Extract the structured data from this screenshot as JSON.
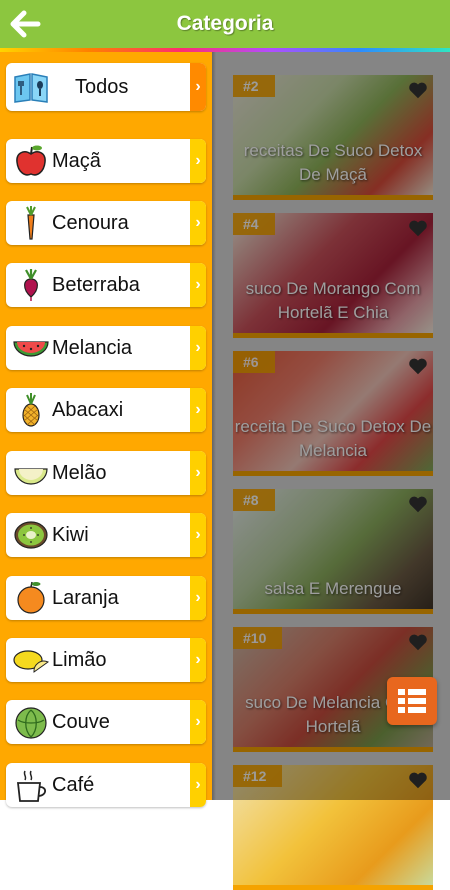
{
  "header": {
    "title": "Categoria",
    "back_icon": "arrow-left-icon",
    "bar_color": "#8cc63f"
  },
  "categories": [
    {
      "label": "Todos",
      "icon": "menu-book-icon"
    },
    {
      "label": "Maçã",
      "icon": "apple-icon"
    },
    {
      "label": "Cenoura",
      "icon": "carrot-icon"
    },
    {
      "label": "Beterraba",
      "icon": "beet-icon"
    },
    {
      "label": "Melancia",
      "icon": "watermelon-icon"
    },
    {
      "label": "Abacaxi",
      "icon": "pineapple-icon"
    },
    {
      "label": "Melão",
      "icon": "melon-icon"
    },
    {
      "label": "Kiwi",
      "icon": "kiwi-icon"
    },
    {
      "label": "Laranja",
      "icon": "orange-icon"
    },
    {
      "label": "Limão",
      "icon": "lemon-icon"
    },
    {
      "label": "Couve",
      "icon": "cabbage-icon"
    },
    {
      "label": "Café",
      "icon": "coffee-cup-icon"
    }
  ],
  "recipes": [
    {
      "rank": "#2",
      "title": "receitas De Suco Detox De Maçã"
    },
    {
      "rank": "#4",
      "title": "suco De Morango Com Hortelã E Chia"
    },
    {
      "rank": "#6",
      "title": "receita De Suco Detox De Melancia"
    },
    {
      "rank": "#8",
      "title": "salsa E Merengue"
    },
    {
      "rank": "#10",
      "title": "suco De Melancia Com Hortelã"
    },
    {
      "rank": "#12",
      "title": ""
    }
  ],
  "colors": {
    "drawer": "#ffa800",
    "accent": "#f5a300",
    "chevron": "#ffd000",
    "fab": "#e8671e"
  }
}
